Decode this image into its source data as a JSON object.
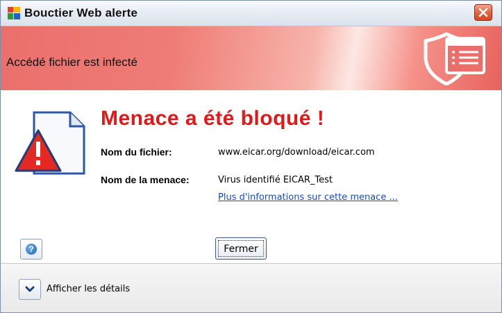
{
  "window": {
    "title": "Bouctier Web alerte",
    "close_icon": "close-icon"
  },
  "banner": {
    "title": "Accédé fichier est infecté",
    "icon": "shield-document-icon"
  },
  "alert": {
    "icon": "warning-document-icon",
    "headline": "Menace a été bloqué !",
    "file_label": "Nom du fichier:",
    "file_value": "www.eicar.org/download/eicar.com",
    "threat_label": "Nom de la menace:",
    "threat_value": "Virus identifié EICAR_Test",
    "more_info_link": "Plus d'informations sur cette menace ..."
  },
  "buttons": {
    "help_icon": "help-icon",
    "close_label": "Fermer"
  },
  "footer": {
    "expand_icon": "chevron-down-icon",
    "details_label": "Afficher les détails"
  },
  "colors": {
    "headline": "#e11919",
    "banner": "#ea6f6b",
    "link": "#1648d8"
  }
}
